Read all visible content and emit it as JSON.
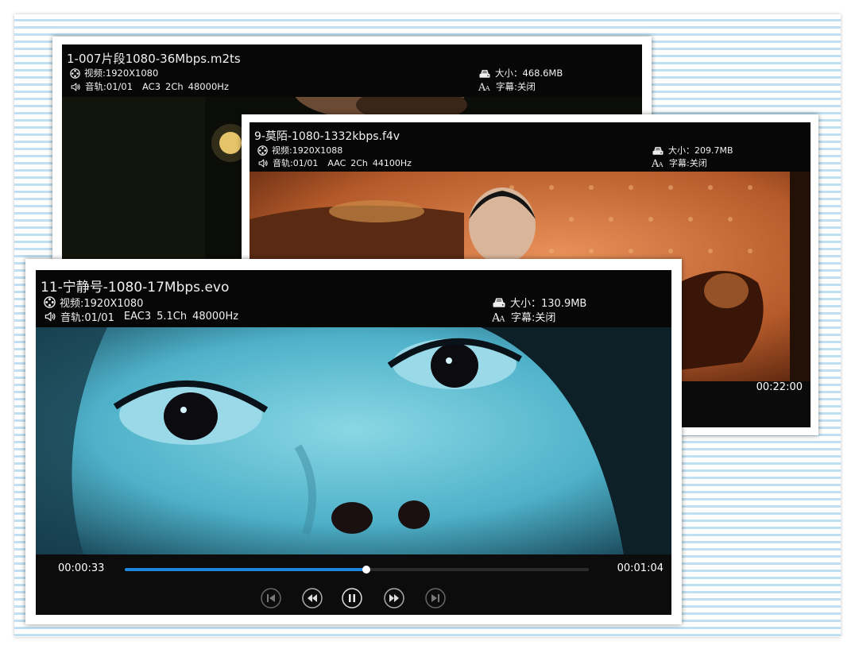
{
  "screens": [
    {
      "title": "1-007片段1080-36Mbps.m2ts",
      "video_label": "视频:1920X1080",
      "audio_label": "音轨:01/01",
      "audio_codec": "AC3",
      "audio_channels": "2Ch",
      "audio_rate": "48000Hz",
      "size_label": "大小：468.6MB",
      "subtitle_label": "字幕:关闭"
    },
    {
      "title": "9-莫陌-1080-1332kbps.f4v",
      "video_label": "视频:1920X1088",
      "audio_label": "音轨:01/01",
      "audio_codec": "AAC",
      "audio_channels": "2Ch",
      "audio_rate": "44100Hz",
      "size_label": "大小：209.7MB",
      "subtitle_label": "字幕:关闭",
      "total_time": "00:22:00"
    },
    {
      "title": "11-宁静号-1080-17Mbps.evo",
      "video_label": "视频:1920X1080",
      "audio_label": "音轨:01/01",
      "audio_codec": "EAC3",
      "audio_channels": "5.1Ch",
      "audio_rate": "48000Hz",
      "size_label": "大小：130.9MB",
      "subtitle_label": "字幕:关闭",
      "current_time": "00:00:33",
      "total_time": "00:01:04",
      "progress": 0.52
    }
  ],
  "icons": {
    "video": "film-reel-icon",
    "audio": "speaker-icon",
    "size": "disk-icon",
    "subtitle": "subtitle-aa-icon",
    "prev": "skip-previous-icon",
    "rewind": "rewind-icon",
    "pause": "pause-icon",
    "forward": "fast-forward-icon",
    "next": "skip-next-icon"
  },
  "colors": {
    "progress_fill": "#1f86e0",
    "sheet_stripe": "#bfe0f3"
  }
}
